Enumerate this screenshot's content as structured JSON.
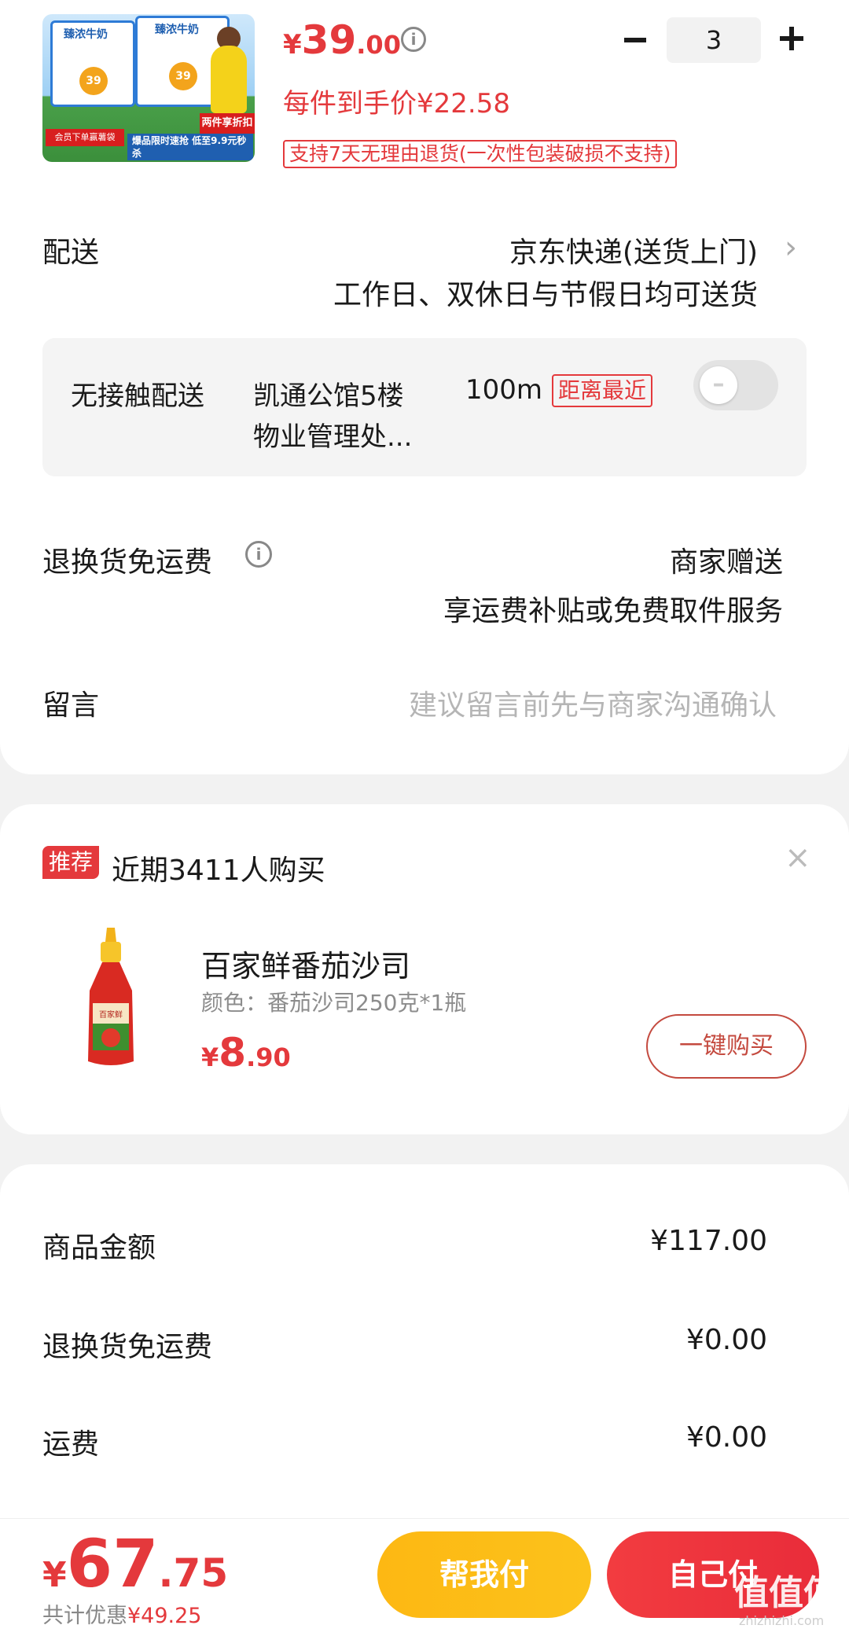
{
  "product": {
    "thumb_brand": "臻浓牛奶",
    "thumb_badge": "39",
    "thumb_tag_red": "两件享折扣",
    "thumb_tag_blue": "爆品限时速抢 低至9.9元秒杀",
    "thumb_tag_left": "会员下单赢薯袋",
    "price_yen": "¥",
    "price_int": "39",
    "price_dec": ".00",
    "per_price": "每件到手价¥22.58",
    "return_tag": "支持7天无理由退货(一次性包装破损不支持)",
    "quantity": "3"
  },
  "delivery": {
    "label": "配送",
    "method": "京东快递(送货上门)",
    "schedule": "工作日、双休日与节假日均可送货"
  },
  "contactless": {
    "label": "无接触配送",
    "place_line1": "凯通公馆5楼",
    "place_line2": "物业管理处...",
    "distance": "100m",
    "nearest_tag": "距离最近",
    "enabled": false
  },
  "return_shipping": {
    "label": "退换货免运费",
    "value_line1": "商家赠送",
    "value_line2": "享运费补贴或免费取件服务"
  },
  "message": {
    "label": "留言",
    "placeholder": "建议留言前先与商家沟通确认"
  },
  "recommend": {
    "badge": "推荐",
    "title": "近期3411人购买",
    "item_name": "百家鲜番茄沙司",
    "item_spec": "颜色：番茄沙司250克*1瓶",
    "price_yen": "¥",
    "price_int": "8",
    "price_dec": ".90",
    "buy_button": "一键购买",
    "bottle_label": "百家鲜"
  },
  "summary": {
    "rows": [
      {
        "label": "商品金额",
        "value": "¥117.00"
      },
      {
        "label": "退换货免运费",
        "value": "¥0.00"
      },
      {
        "label": "运费",
        "value": "¥0.00"
      }
    ]
  },
  "footer": {
    "total_yen": "¥",
    "total_int": "67",
    "total_dec": ".75",
    "discount_label": "共计优惠",
    "discount_value": "¥49.25",
    "help_pay": "帮我付",
    "self_pay": "自己付",
    "watermark": "值值值",
    "watermark_url": "zhizhizhi.com"
  },
  "colors": {
    "accent_red": "#e4393c",
    "help_pay_yellow": "#fdb813",
    "self_pay_red": "#f23c40"
  },
  "icons": [
    "info-icon",
    "chevron-right-icon",
    "toggle-off-icon",
    "close-icon",
    "minus-icon",
    "plus-icon"
  ]
}
